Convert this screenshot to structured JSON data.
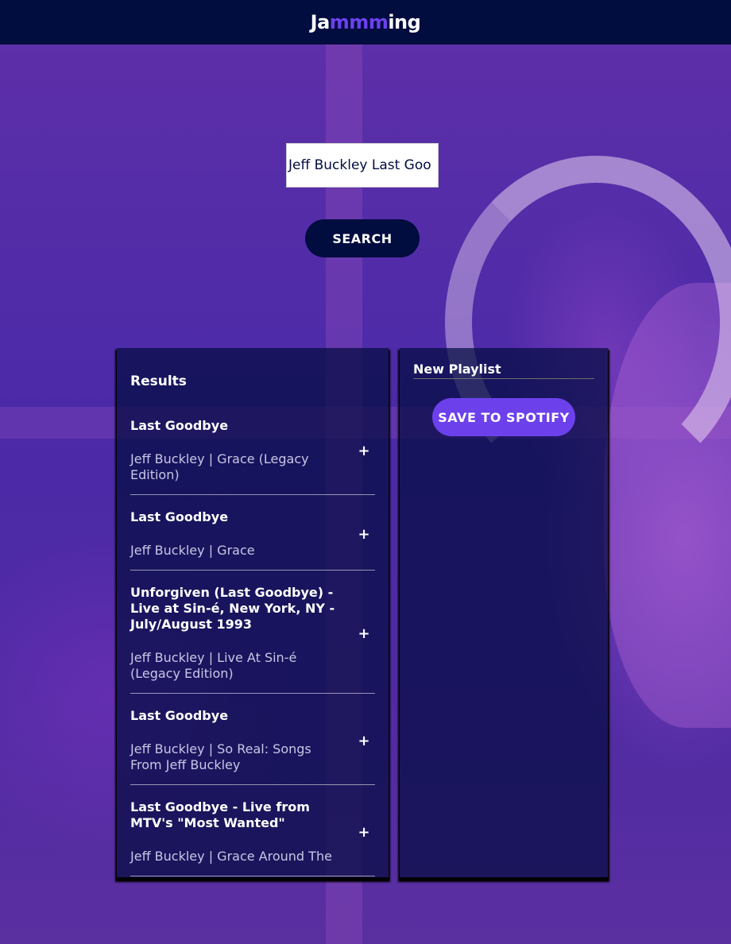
{
  "app": {
    "logo_prefix": "Ja",
    "logo_accent": "mmm",
    "logo_suffix": "ing",
    "accent_color": "#6c41ec",
    "header_color": "#010c3f"
  },
  "search": {
    "value": "Jeff Buckley Last Goo",
    "button_label": "SEARCH"
  },
  "results": {
    "title": "Results",
    "add_icon": "+",
    "tracks": [
      {
        "name": "Last Goodbye",
        "meta": "Jeff Buckley | Grace (Legacy Edition)"
      },
      {
        "name": "Last Goodbye",
        "meta": "Jeff Buckley | Grace"
      },
      {
        "name": "Unforgiven (Last Goodbye) - Live at Sin-é, New York, NY - July/August 1993",
        "meta": "Jeff Buckley | Live At Sin-é (Legacy Edition)"
      },
      {
        "name": "Last Goodbye",
        "meta": "Jeff Buckley | So Real: Songs From Jeff Buckley"
      },
      {
        "name": "Last Goodbye - Live from MTV's \"Most Wanted\"",
        "meta": "Jeff Buckley | Grace Around The"
      }
    ]
  },
  "playlist": {
    "name": "New Playlist",
    "save_label": "SAVE TO SPOTIFY"
  }
}
